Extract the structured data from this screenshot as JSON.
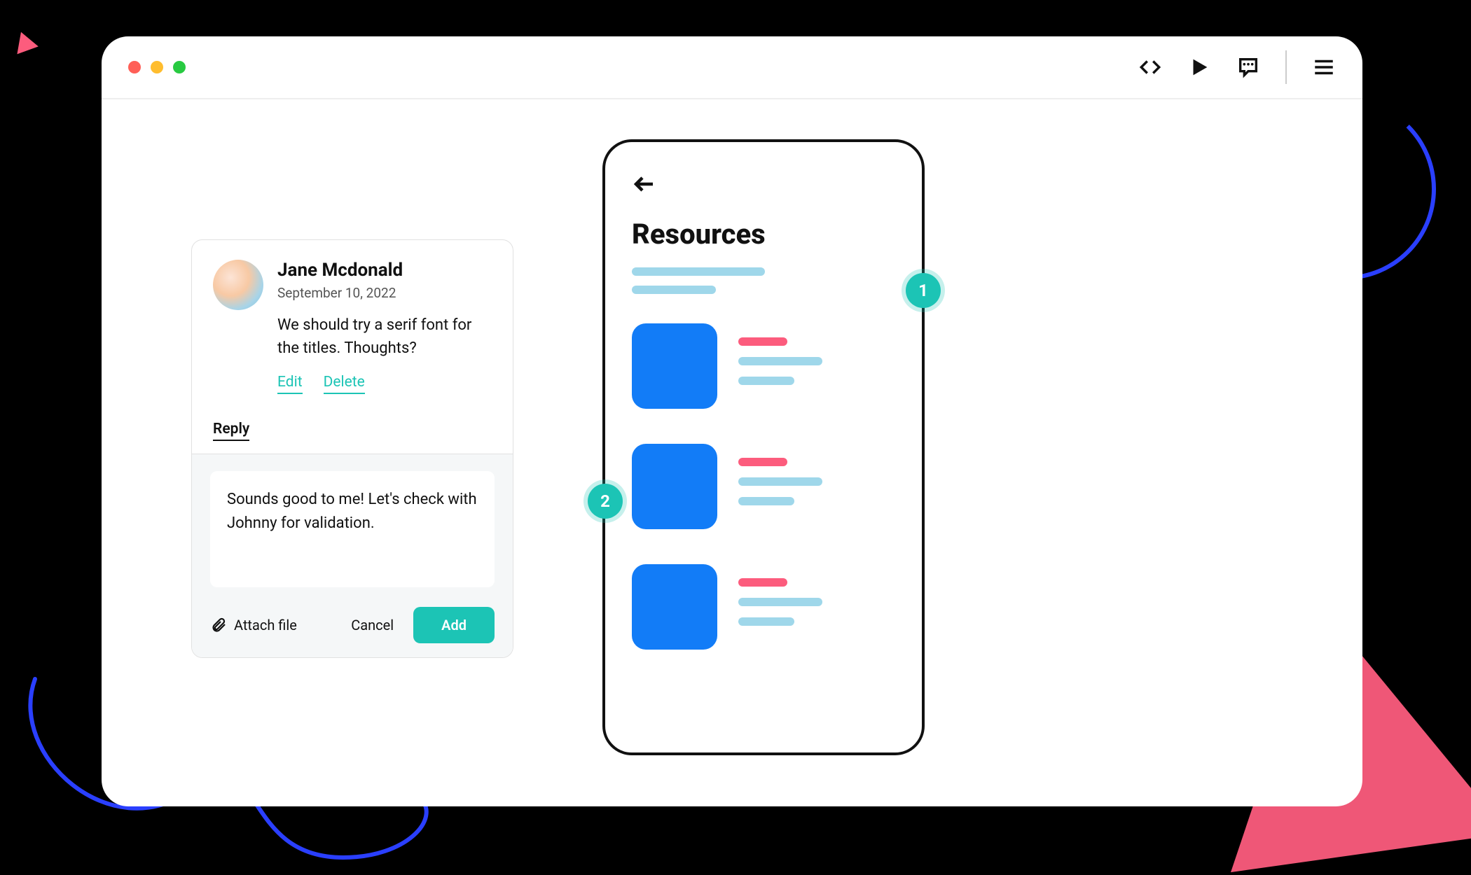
{
  "toolbar": {
    "code_icon": "code-icon",
    "play_icon": "play-icon",
    "comment_icon": "comment-icon",
    "menu_icon": "menu-icon"
  },
  "comment": {
    "author": "Jane Mcdonald",
    "date": "September 10, 2022",
    "body": "We should try a serif font for the titles. Thoughts?",
    "edit_label": "Edit",
    "delete_label": "Delete",
    "reply_label": "Reply",
    "reply_text": "Sounds good to me! Let's check with Johnny for validation.",
    "attach_label": "Attach file",
    "cancel_label": "Cancel",
    "add_label": "Add"
  },
  "phone": {
    "title": "Resources"
  },
  "pins": {
    "p1": "1",
    "p2": "2"
  },
  "colors": {
    "accent_teal": "#1cc4b5",
    "accent_pink": "#fc5c7d",
    "accent_blue": "#127cf7",
    "placeholder_blue": "#9fd7ea",
    "decorative_indigo": "#2a3fff"
  }
}
